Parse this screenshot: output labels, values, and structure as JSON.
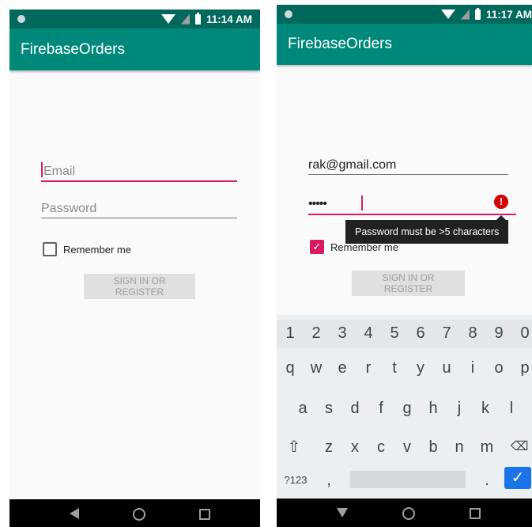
{
  "left_screen": {
    "status_time": "11:14 AM",
    "app_title": "FirebaseOrders",
    "email_placeholder": "Email",
    "password_placeholder": "Password",
    "remember_label": "Remember me",
    "sign_in_label": "SIGN IN OR REGISTER"
  },
  "right_screen": {
    "status_time": "11:17 AM",
    "app_title": "FirebaseOrders",
    "email_value": "rak@gmail.com",
    "password_value": "•••••",
    "error_message": "Password must be >5 characters",
    "remember_label": "Remember me",
    "sign_in_label": "SIGN IN OR REGISTER",
    "keyboard": {
      "number_row": [
        "1",
        "2",
        "3",
        "4",
        "5",
        "6",
        "7",
        "8",
        "9",
        "0"
      ],
      "row1": [
        "q",
        "w",
        "e",
        "r",
        "t",
        "y",
        "u",
        "i",
        "o",
        "p"
      ],
      "row2": [
        "a",
        "s",
        "d",
        "f",
        "g",
        "h",
        "j",
        "k",
        "l"
      ],
      "row3": [
        "z",
        "x",
        "c",
        "v",
        "b",
        "n",
        "m"
      ],
      "symbols_label": "?123",
      "comma": ",",
      "period": "."
    }
  },
  "colors": {
    "status_bar": "#00695c",
    "app_bar": "#00897b",
    "accent": "#d81b60",
    "error": "#d50000",
    "keyboard_enter": "#1a73e8"
  },
  "icons": [
    "wifi-icon",
    "no-sim-icon",
    "battery-icon",
    "back-icon",
    "home-icon",
    "recents-icon",
    "error-icon",
    "shift-icon",
    "backspace-icon",
    "checkmark-icon"
  ]
}
